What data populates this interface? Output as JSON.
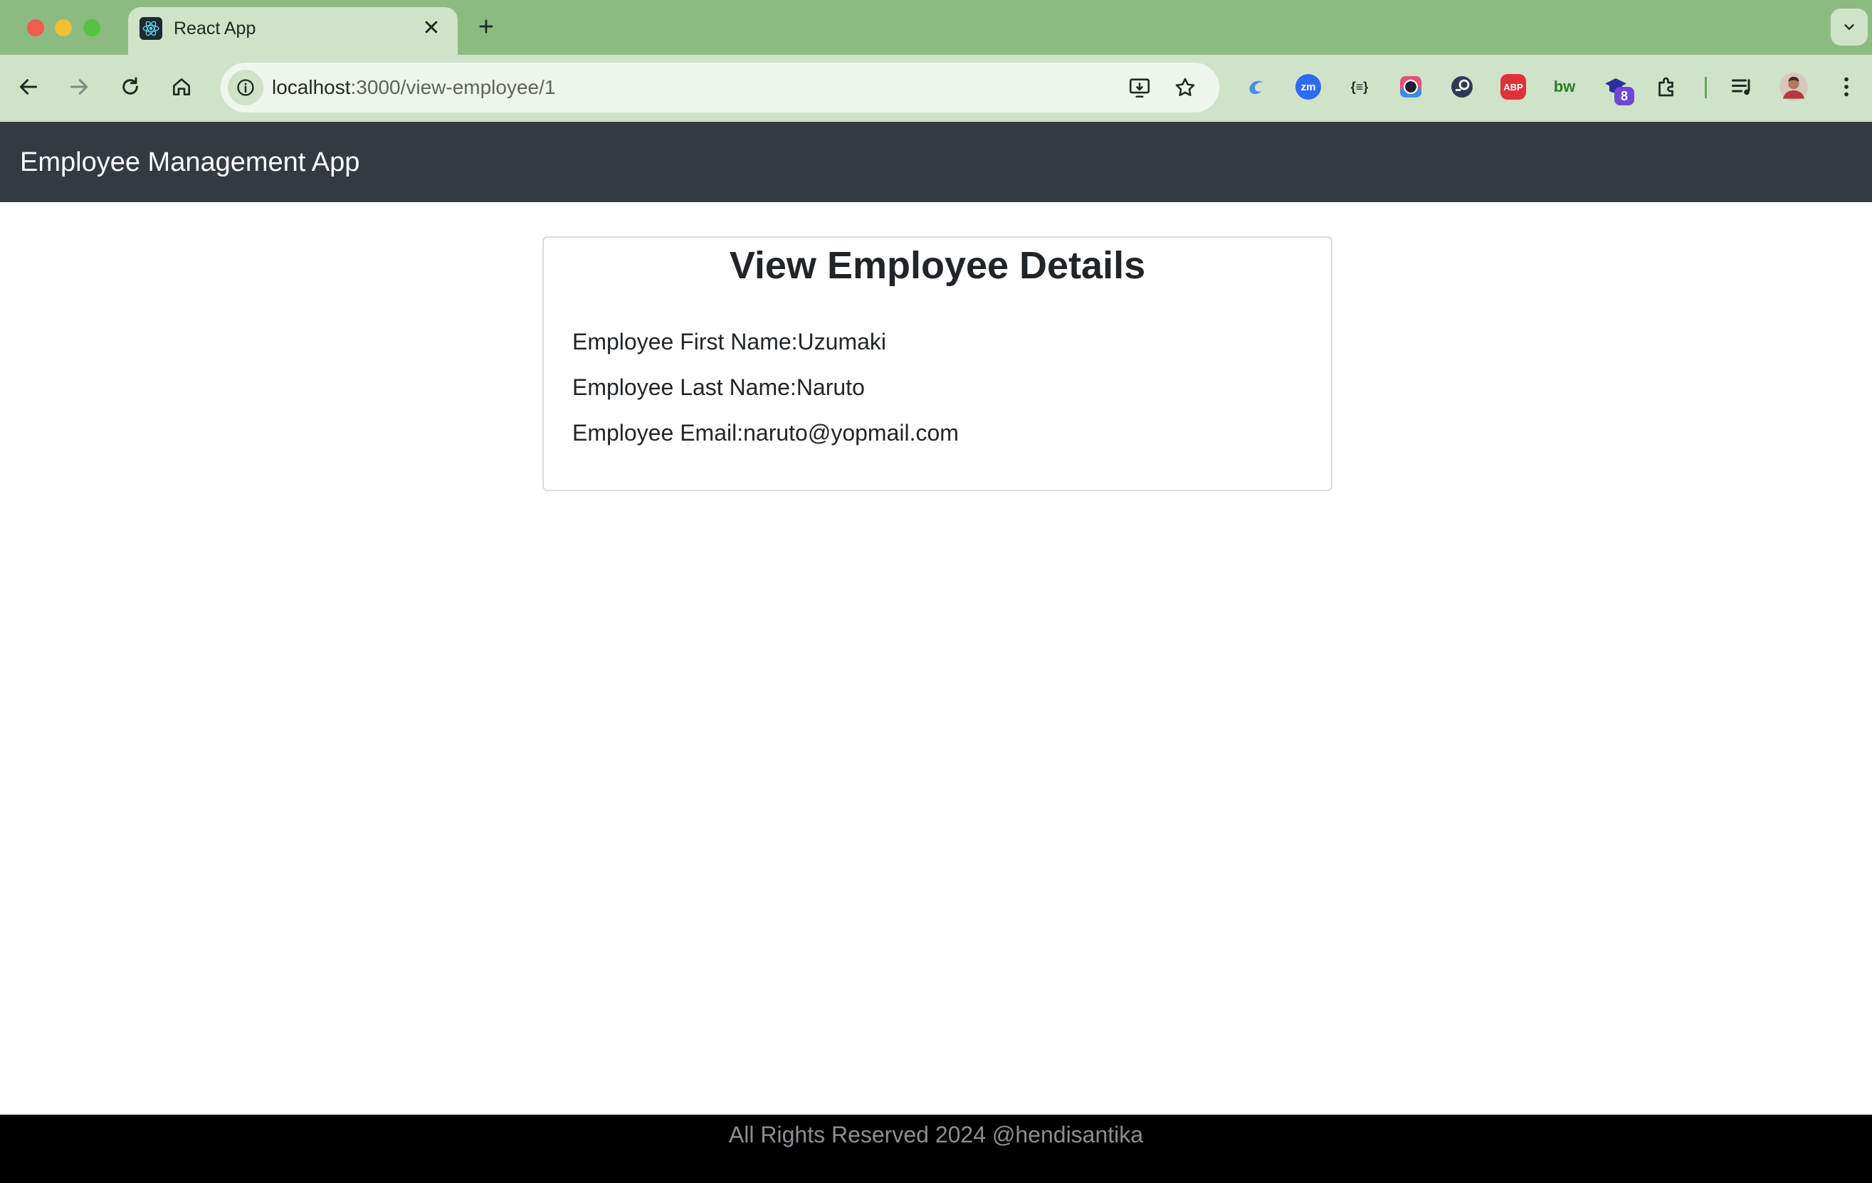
{
  "browser": {
    "tab": {
      "title": "React App",
      "favicon": "react-icon"
    },
    "url": {
      "host": "localhost",
      "path": ":3000/view-employee/1"
    },
    "extensions": [
      {
        "name": "swirl-extension-icon",
        "label": ""
      },
      {
        "name": "zoom-extension-icon",
        "label": "zm"
      },
      {
        "name": "json-extension-icon",
        "label": "{≡}"
      },
      {
        "name": "color-picker-extension-icon",
        "label": ""
      },
      {
        "name": "seo-extension-icon",
        "label": ""
      },
      {
        "name": "adblock-extension-icon",
        "label": "ABP"
      },
      {
        "name": "bw-extension-icon",
        "label": "bw"
      },
      {
        "name": "grad-cap-extension-icon",
        "label": "",
        "badge": "8"
      }
    ]
  },
  "app": {
    "brand": "Employee Management App",
    "card": {
      "title": "View Employee Details",
      "fields": [
        {
          "label": "Employee First Name:",
          "value": "Uzumaki"
        },
        {
          "label": "Employee Last Name:",
          "value": "Naruto"
        },
        {
          "label": "Employee Email:",
          "value": "naruto@yopmail.com"
        }
      ]
    },
    "footer": "All Rights Reserved 2024 @hendisantika"
  },
  "colors": {
    "tabstrip": "#8bbb80",
    "toolbar": "#cfe3c9",
    "navbar": "#343a40",
    "footer": "#000000"
  }
}
